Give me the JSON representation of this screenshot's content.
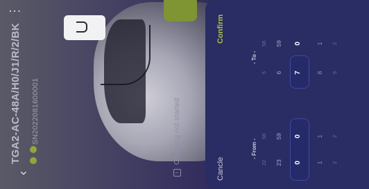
{
  "header": {
    "title": "TGA2-AC-48A/H0/J1/R/2/BK",
    "serial": "SN2022081600001"
  },
  "status": {
    "text": "Charging not started"
  },
  "picker": {
    "cancel_label": "Cancle",
    "confirm_label": "Confirm",
    "from_label": "- From -",
    "to_label": "- To -",
    "columns": [
      {
        "far": "22",
        "near": "23",
        "selected": "0",
        "below_near": "1",
        "below_far": "2"
      },
      {
        "far": "58",
        "near": "59",
        "selected": "0",
        "below_near": "1",
        "below_far": "2"
      },
      {
        "far": "5",
        "near": "6",
        "selected": "7",
        "below_near": "8",
        "below_far": "9"
      },
      {
        "far": "58",
        "near": "59",
        "selected": "0",
        "below_near": "1",
        "below_far": "2"
      }
    ]
  },
  "colors": {
    "accent": "#a9c14a",
    "sheet": "#2a2c64",
    "dot": "#8fa73a"
  }
}
